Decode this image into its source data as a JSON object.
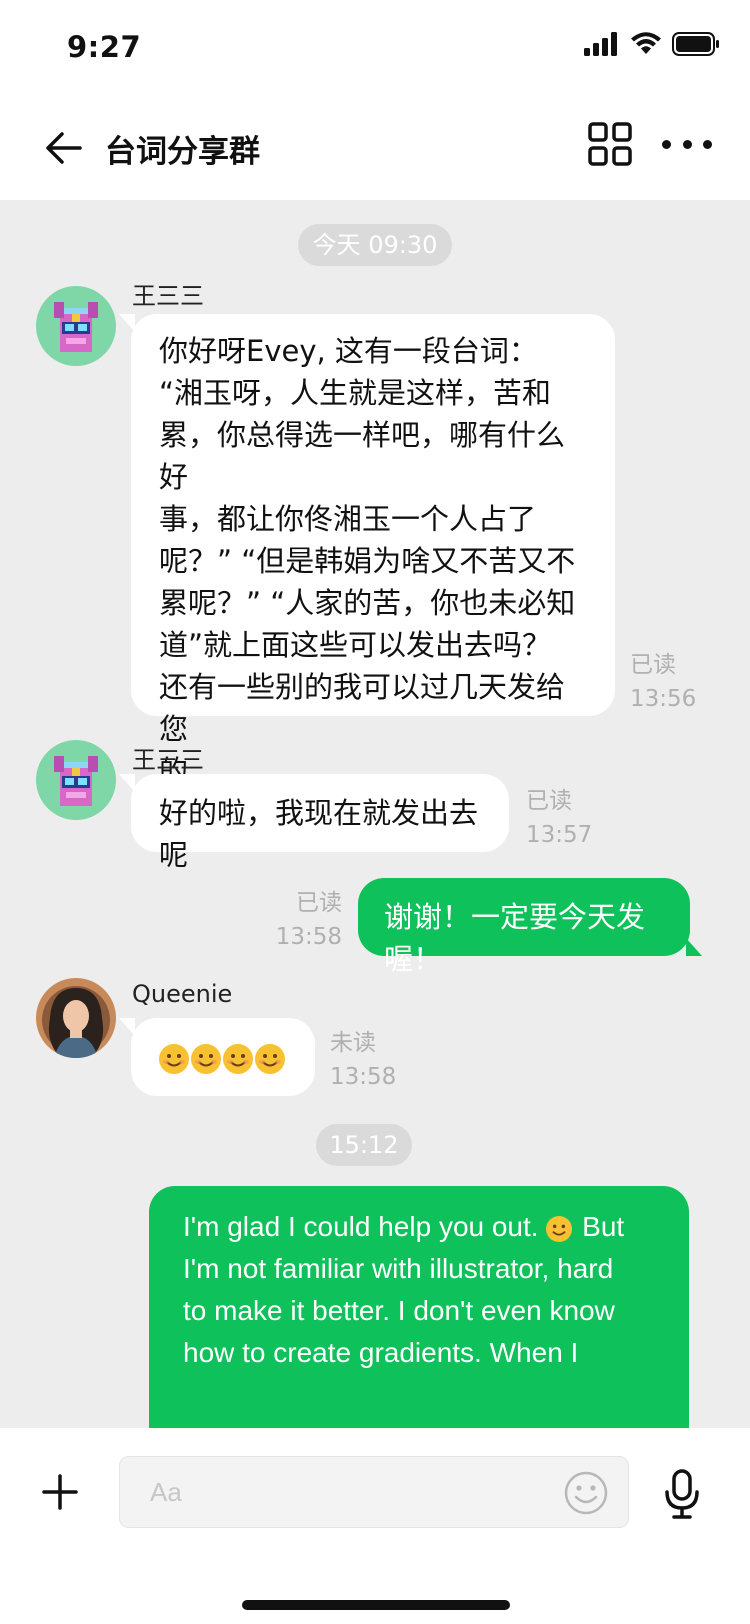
{
  "status_bar": {
    "time": "9:27"
  },
  "header": {
    "title": "台词分享群"
  },
  "chat": {
    "time_stamps": [
      "今天 09:30",
      "15:12"
    ],
    "messages": [
      {
        "sender": "王三三",
        "direction": "incoming",
        "text_lines": [
          "你好呀Evey, 这有一段台词：",
          "“湘玉呀，人生就是这样，苦和",
          "累，你总得选一样吧，哪有什么好",
          "事，都让你佟湘玉一个人占了",
          "呢？” “但是韩娟为啥又不苦又不",
          "累呢？” “人家的苦，你也未必知",
          "道”就上面这些可以发出去吗？",
          "还有一些别的我可以过几天发给您",
          "的"
        ],
        "status": "已读",
        "time": "13:56"
      },
      {
        "sender": "王三三",
        "direction": "incoming",
        "text": "好的啦，我现在就发出去呢",
        "status": "已读",
        "time": "13:57"
      },
      {
        "direction": "outgoing",
        "text": "谢谢！一定要今天发喔！",
        "status": "已读",
        "time": "13:58"
      },
      {
        "sender": "Queenie",
        "direction": "incoming",
        "emoji_count": 4,
        "emoji_icon": "smiling-face-emoji",
        "status": "未读",
        "time": "13:58"
      },
      {
        "direction": "outgoing",
        "text_lines": [
          "I'm glad I could help you out.",
          "But",
          "I'm not familiar with illustrator, hard",
          "to make it better. I don't even know",
          "how to create gradients. When I"
        ]
      }
    ]
  },
  "input_bar": {
    "placeholder": "Aa"
  },
  "colors": {
    "accent_green": "#0ec15a",
    "chat_background": "#ededed",
    "pill_gray": "#dadada"
  }
}
